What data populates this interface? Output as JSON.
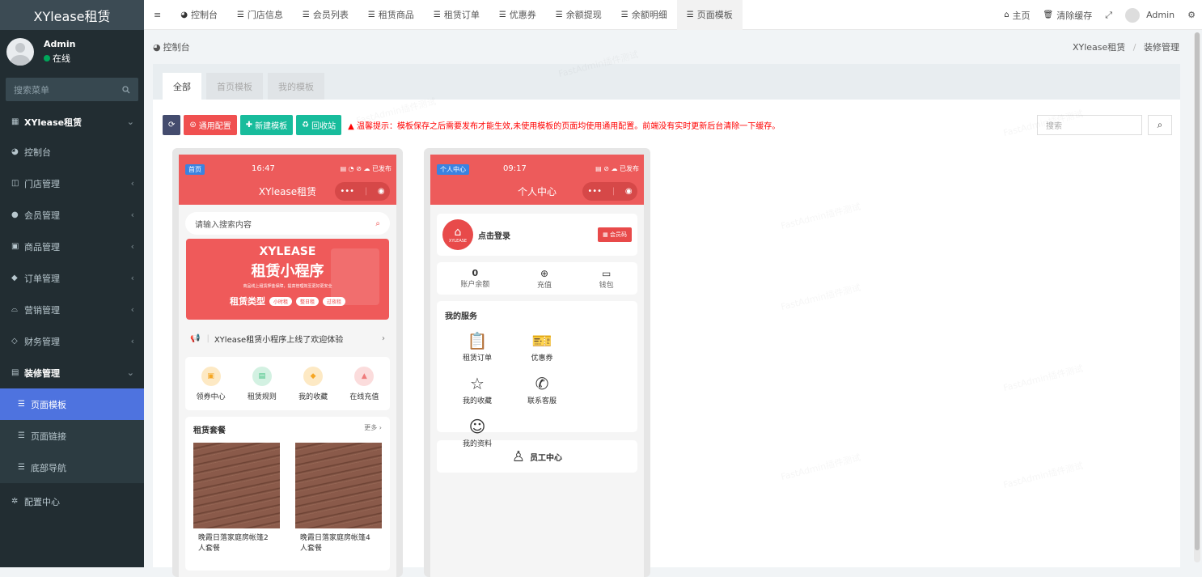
{
  "sidebar": {
    "brand": "XYlease租赁",
    "user_name": "Admin",
    "user_status": "在线",
    "search_placeholder": "搜索菜单",
    "items": [
      {
        "label": "XYlease租赁",
        "icon": "grid-icon"
      },
      {
        "label": "控制台",
        "icon": "dashboard-icon"
      },
      {
        "label": "门店管理",
        "icon": "store-icon"
      },
      {
        "label": "会员管理",
        "icon": "user-icon"
      },
      {
        "label": "商品管理",
        "icon": "goods-icon"
      },
      {
        "label": "订单管理",
        "icon": "order-icon"
      },
      {
        "label": "营销管理",
        "icon": "marketing-icon"
      },
      {
        "label": "财务管理",
        "icon": "finance-icon"
      },
      {
        "label": "装修管理",
        "icon": "decor-icon"
      },
      {
        "label": "页面模板",
        "icon": "list-icon"
      },
      {
        "label": "页面链接",
        "icon": "list-icon"
      },
      {
        "label": "底部导航",
        "icon": "list-icon"
      },
      {
        "label": "配置中心",
        "icon": "gear-icon"
      }
    ]
  },
  "topbar": {
    "tabs": [
      "控制台",
      "门店信息",
      "会员列表",
      "租赁商品",
      "租赁订单",
      "优惠券",
      "余额提现",
      "余额明细",
      "页面模板"
    ],
    "home": "主页",
    "clear_cache": "清除缓存",
    "admin": "Admin"
  },
  "breadcrumb": {
    "left": "控制台",
    "right_1": "XYlease租赁",
    "sep": "/",
    "right_2": "装修管理"
  },
  "panel": {
    "tabs": [
      "全部",
      "首页模板",
      "我的模板"
    ],
    "buttons": {
      "config": "通用配置",
      "new": "新建模板",
      "recycle": "回收站"
    },
    "warning": "温馨提示：模板保存之后需要发布才能生效,未使用模板的页面均使用通用配置。前端没有实时更新后台清除一下缓存。",
    "search_placeholder": "搜索"
  },
  "watermark": "FastAdmin插件测试",
  "phone1": {
    "tag": "首页",
    "time": "16:47",
    "status": "已发布",
    "title": "XYlease租赁",
    "search_placeholder": "请输入搜索内容",
    "banner_brand": "XYLEASE",
    "banner_title": "租赁小程序",
    "banner_sub": "商品线上租赁押金保障，提高管理效至更好更安全",
    "banner_type_label": "租赁类型",
    "banner_chips": [
      "小时租",
      "整日租",
      "过夜租"
    ],
    "notice": "XYlease租赁小程序上线了欢迎体验",
    "nav": [
      {
        "label": "领券中心",
        "icon": "coupon-icon",
        "color": "#f5a623"
      },
      {
        "label": "租赁规则",
        "icon": "rules-icon",
        "color": "#3dbf7f"
      },
      {
        "label": "我的收藏",
        "icon": "favorite-icon",
        "color": "#f5a623"
      },
      {
        "label": "在线充值",
        "icon": "recharge-icon",
        "color": "#ef7b7b"
      }
    ],
    "package_title": "租赁套餐",
    "more": "更多",
    "products": [
      {
        "name": "晚霞日落家庭房帐篷2人套餐"
      },
      {
        "name": "晚霞日落家庭房帐篷4人套餐"
      }
    ]
  },
  "phone2": {
    "tag": "个人中心",
    "time": "09:17",
    "status": "已发布",
    "title": "个人中心",
    "login": "点击登录",
    "logo_text": "XYLEASE",
    "member_code": "会员码",
    "balance_value": "0",
    "balance_label": "账户余额",
    "recharge": "充值",
    "wallet": "钱包",
    "services_title": "我的服务",
    "services": [
      {
        "label": "租赁订单",
        "icon": "order-clipboard-icon"
      },
      {
        "label": "优惠券",
        "icon": "coupon-ticket-icon"
      },
      {
        "label": "我的收藏",
        "icon": "star-icon"
      },
      {
        "label": "联系客服",
        "icon": "phone-icon"
      },
      {
        "label": "我的资料",
        "icon": "profile-edit-icon"
      }
    ],
    "staff": "员工中心"
  }
}
